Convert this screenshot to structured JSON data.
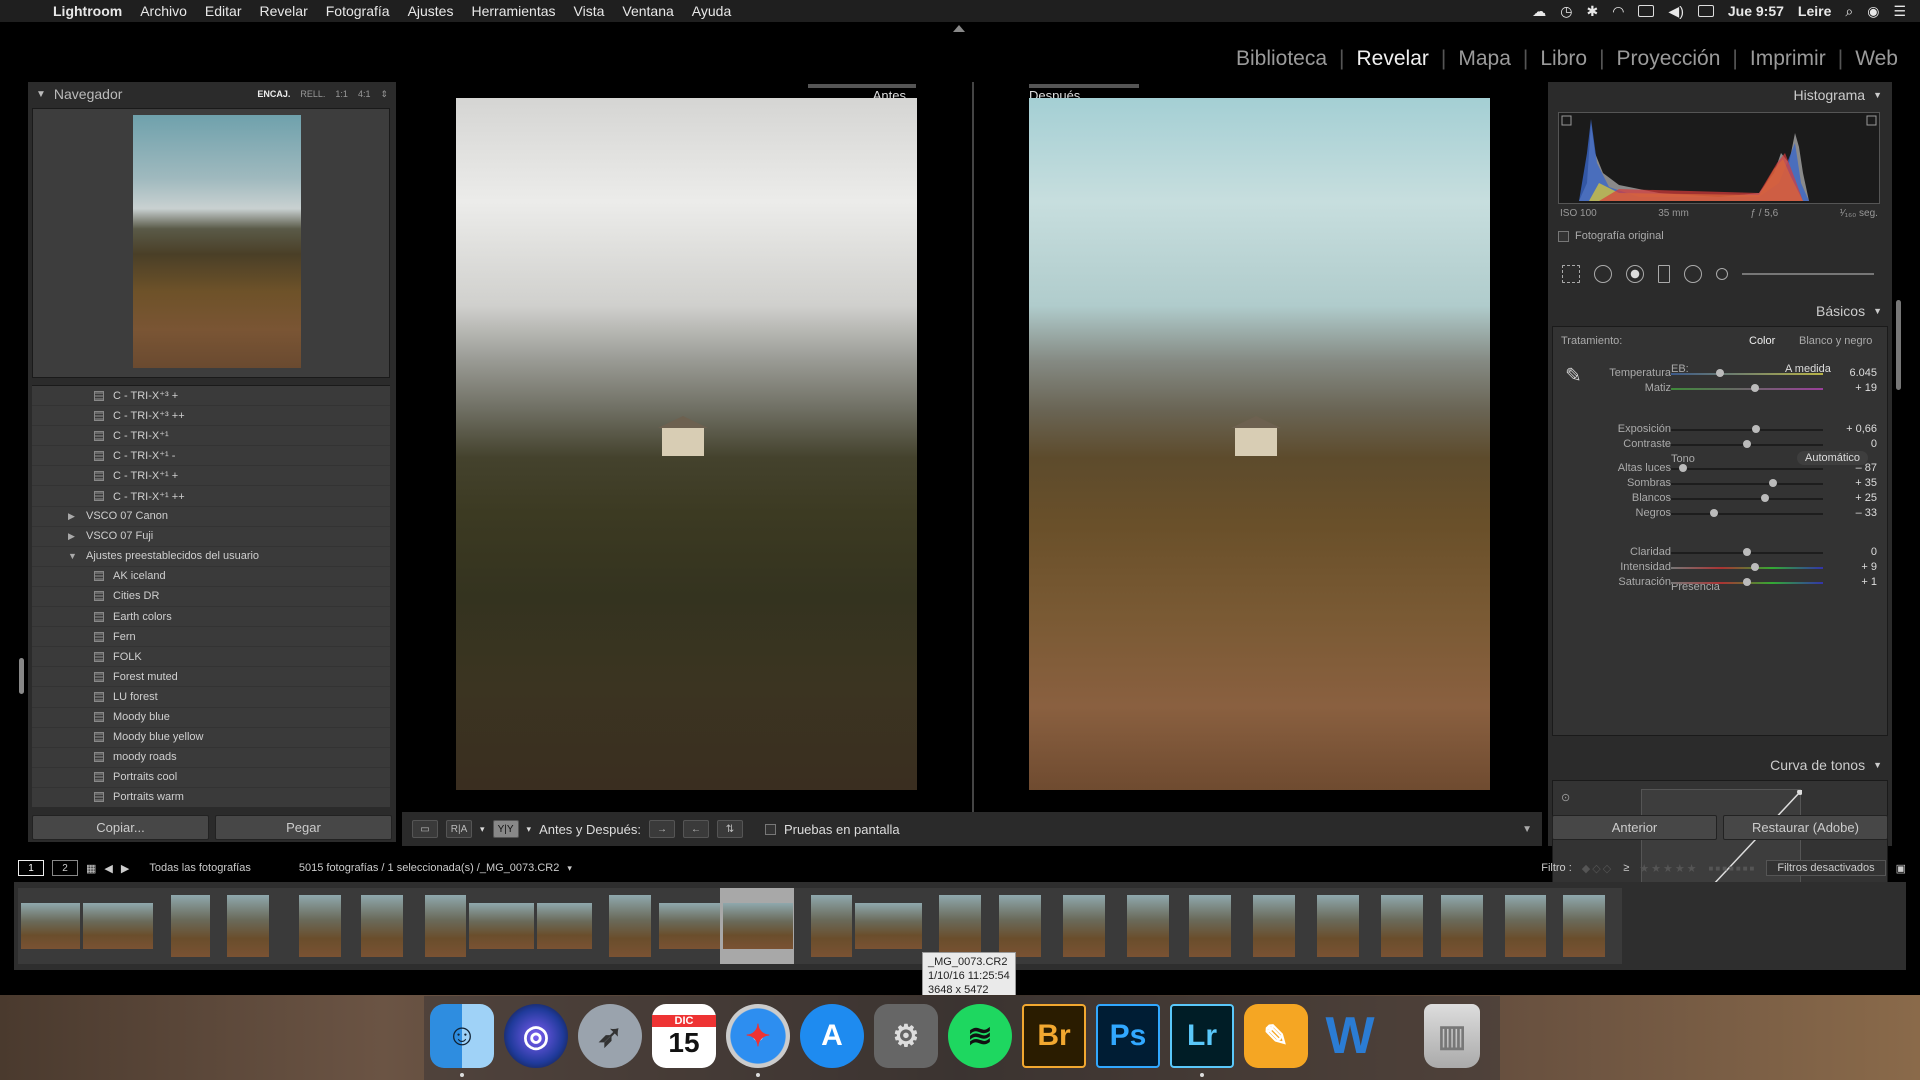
{
  "menubar": {
    "apple": "",
    "app": "Lightroom",
    "items": [
      "Archivo",
      "Editar",
      "Revelar",
      "Fotografía",
      "Ajustes",
      "Herramientas",
      "Vista",
      "Ventana",
      "Ayuda"
    ],
    "clock": "Jue 9:57",
    "user": "Leire"
  },
  "modules": [
    "Biblioteca",
    "Revelar",
    "Mapa",
    "Libro",
    "Proyección",
    "Imprimir",
    "Web"
  ],
  "active_module": "Revelar",
  "navigator": {
    "title": "Navegador",
    "zoom_options": [
      "ENCAJ.",
      "RELL.",
      "1:1",
      "4:1"
    ]
  },
  "presets": {
    "rows": [
      {
        "type": "item",
        "label": "C - TRI-X⁺³ +"
      },
      {
        "type": "item",
        "label": "C - TRI-X⁺³ ++"
      },
      {
        "type": "item",
        "label": "C - TRI-X⁺¹"
      },
      {
        "type": "item",
        "label": "C - TRI-X⁺¹ -"
      },
      {
        "type": "item",
        "label": "C - TRI-X⁺¹ +"
      },
      {
        "type": "item",
        "label": "C - TRI-X⁺¹ ++"
      },
      {
        "type": "folder",
        "label": "VSCO 07 Canon",
        "open": false
      },
      {
        "type": "folder",
        "label": "VSCO 07 Fuji",
        "open": false
      },
      {
        "type": "folder",
        "label": "Ajustes preestablecidos del usuario",
        "open": true
      },
      {
        "type": "item",
        "label": "AK iceland"
      },
      {
        "type": "item",
        "label": "Cities DR"
      },
      {
        "type": "item",
        "label": "Earth colors"
      },
      {
        "type": "item",
        "label": "Fern"
      },
      {
        "type": "item",
        "label": "FOLK"
      },
      {
        "type": "item",
        "label": "Forest muted"
      },
      {
        "type": "item",
        "label": "LU forest"
      },
      {
        "type": "item",
        "label": "Moody blue"
      },
      {
        "type": "item",
        "label": "Moody blue yellow"
      },
      {
        "type": "item",
        "label": "moody roads"
      },
      {
        "type": "item",
        "label": "Portraits cool"
      },
      {
        "type": "item",
        "label": "Portraits warm"
      }
    ]
  },
  "left_buttons": {
    "copy": "Copiar...",
    "paste": "Pegar"
  },
  "view": {
    "before": "Antes",
    "after": "Después"
  },
  "toolbar": {
    "before_after_label": "Antes y Después:",
    "softproof": "Pruebas en pantalla",
    "ra": "R|A",
    "yy": "Y|Y"
  },
  "histogram": {
    "title": "Histograma",
    "iso": "ISO 100",
    "focal": "35 mm",
    "aperture": "ƒ / 5,6",
    "shutter": "¹⁄₁₆₀ seg.",
    "original": "Fotografía original"
  },
  "basics": {
    "title": "Básicos",
    "treatment": "Tratamiento:",
    "color": "Color",
    "bw": "Blanco y negro",
    "wb_label": "EB:",
    "wb_value": "A medida",
    "tone_label": "Tono",
    "auto": "Automático",
    "presence_label": "Presencia",
    "sliders": [
      {
        "key": "temp",
        "label": "Temperatura",
        "value": "6.045",
        "pos": 0.32
      },
      {
        "key": "tint",
        "label": "Matiz",
        "value": "+ 19",
        "pos": 0.55
      },
      {
        "key": "exp",
        "label": "Exposición",
        "value": "+ 0,66",
        "pos": 0.56
      },
      {
        "key": "con",
        "label": "Contraste",
        "value": "0",
        "pos": 0.5
      },
      {
        "key": "hl",
        "label": "Altas luces",
        "value": "– 87",
        "pos": 0.08
      },
      {
        "key": "sh",
        "label": "Sombras",
        "value": "+ 35",
        "pos": 0.67
      },
      {
        "key": "wh",
        "label": "Blancos",
        "value": "+ 25",
        "pos": 0.62
      },
      {
        "key": "bl",
        "label": "Negros",
        "value": "– 33",
        "pos": 0.28
      },
      {
        "key": "cla",
        "label": "Claridad",
        "value": "0",
        "pos": 0.5
      },
      {
        "key": "vib",
        "label": "Intensidad",
        "value": "+ 9",
        "pos": 0.55
      },
      {
        "key": "sat",
        "label": "Saturación",
        "value": "+ 1",
        "pos": 0.5
      }
    ]
  },
  "curve": {
    "title": "Curva de tonos"
  },
  "right_buttons": {
    "prev": "Anterior",
    "reset": "Restaurar (Adobe)"
  },
  "filmstrip": {
    "pages": [
      "1",
      "2"
    ],
    "source": "Todas las fotografías",
    "count": "5015 fotografías / 1 seleccionada(s) /_MG_0073.CR2",
    "filter_label": "Filtro :",
    "filter_state": "Filtros desactivados",
    "tooltip": [
      "_MG_0073.CR2",
      "1/10/16 11:25:54",
      "3648 x 5472"
    ]
  },
  "dock": {
    "apps": [
      "Finder",
      "Siri",
      "Launchpad",
      "Calendario",
      "Safari",
      "App Store",
      "Preferencias del Sistema",
      "Spotify",
      "Bridge",
      "Photoshop",
      "Lightroom",
      "Pages",
      "Word",
      "Papelera"
    ],
    "calendar_month": "DIC",
    "calendar_day": "15",
    "br": "Br",
    "ps": "Ps",
    "lr": "Lr"
  }
}
